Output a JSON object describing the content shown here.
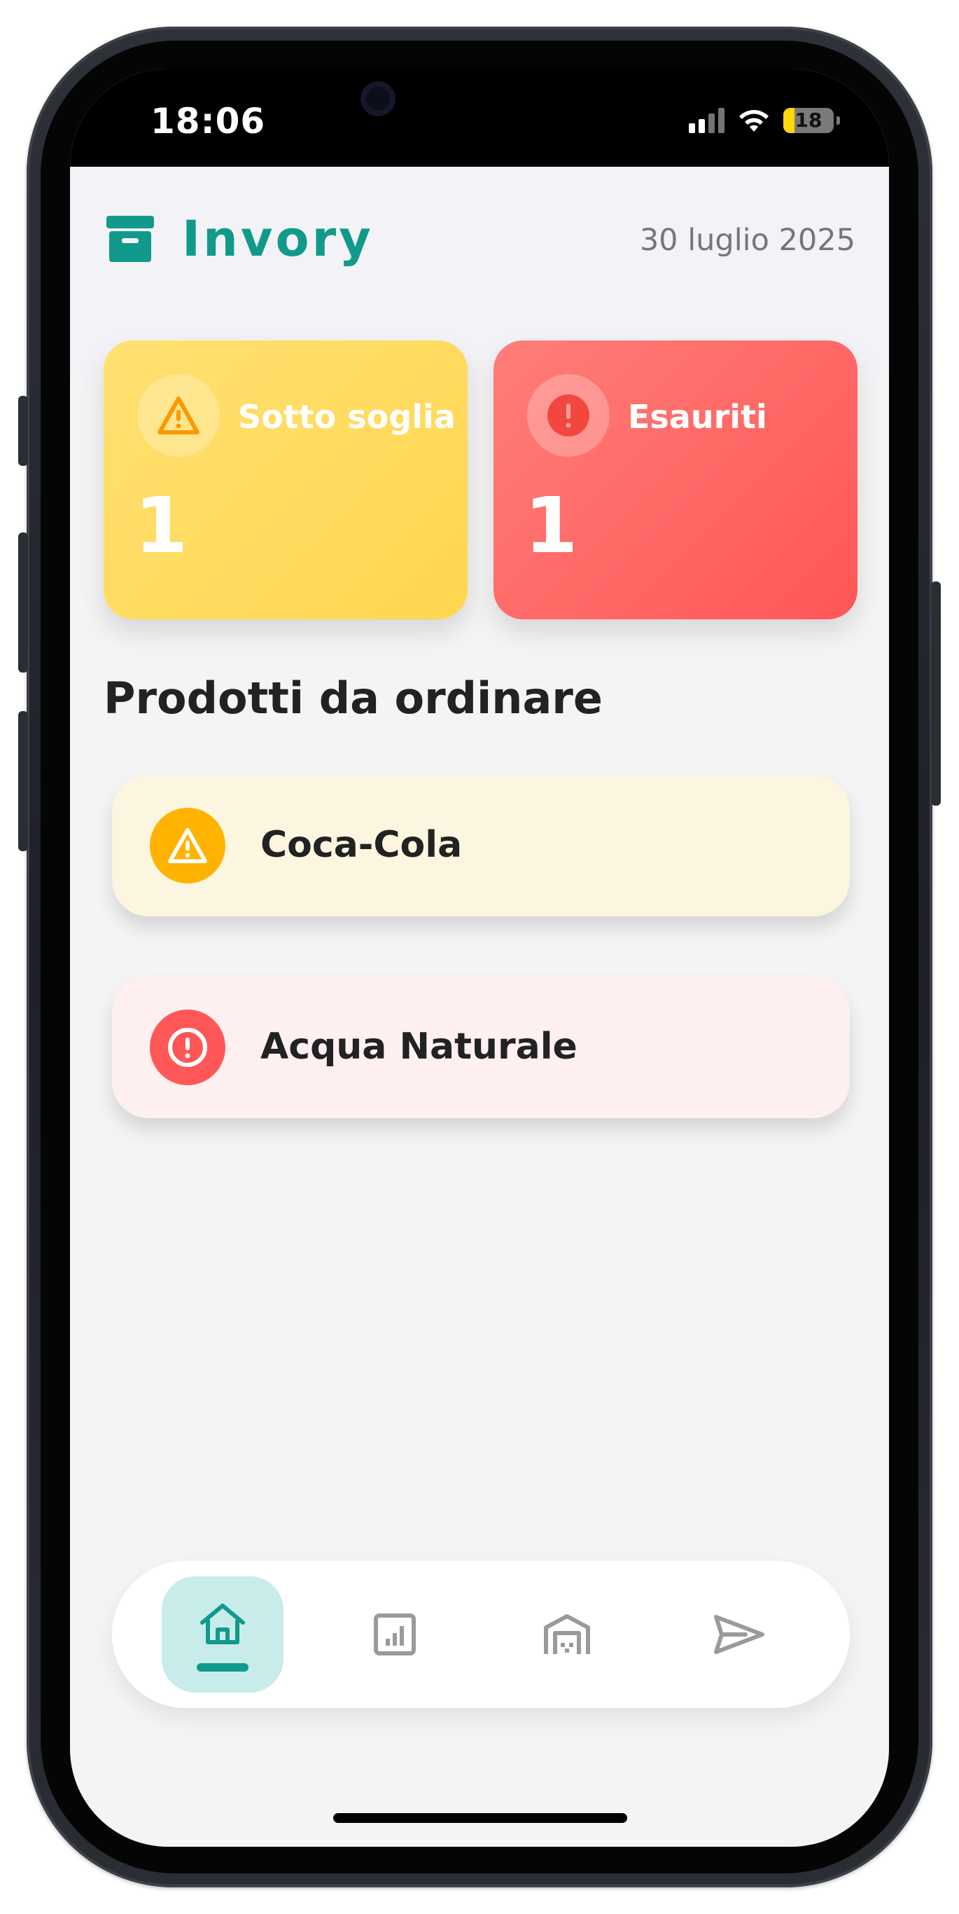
{
  "status_bar": {
    "time": "18:06",
    "battery_level": "18",
    "icons": [
      "signal-icon",
      "wifi-icon",
      "battery-icon"
    ]
  },
  "header": {
    "app_name": "Invory",
    "logo_icon": "archive-box-icon",
    "date": "30 luglio 2025"
  },
  "summary_cards": [
    {
      "label": "Sotto soglia",
      "count": "1",
      "icon": "warning-triangle-icon",
      "color": "#ffd64f"
    },
    {
      "label": "Esauriti",
      "count": "1",
      "icon": "exclamation-circle-icon",
      "color": "#ff5656"
    }
  ],
  "section_title": "Prodotti da ordinare",
  "products": [
    {
      "name": "Coca-Cola",
      "status": "warning",
      "icon": "warning-triangle-icon",
      "color": "#ffb300"
    },
    {
      "name": "Acqua Naturale",
      "status": "out",
      "icon": "exclamation-circle-icon",
      "color": "#ff5757"
    }
  ],
  "bottom_nav": {
    "active": "home",
    "items": [
      {
        "id": "home",
        "icon": "home-icon"
      },
      {
        "id": "reports",
        "icon": "bar-chart-icon"
      },
      {
        "id": "warehouse",
        "icon": "warehouse-icon"
      },
      {
        "id": "send",
        "icon": "paper-plane-icon"
      }
    ]
  },
  "colors": {
    "brand": "#119a8b",
    "warning": "#ffb300",
    "danger": "#ff5757",
    "background": "#f4f4f5"
  }
}
